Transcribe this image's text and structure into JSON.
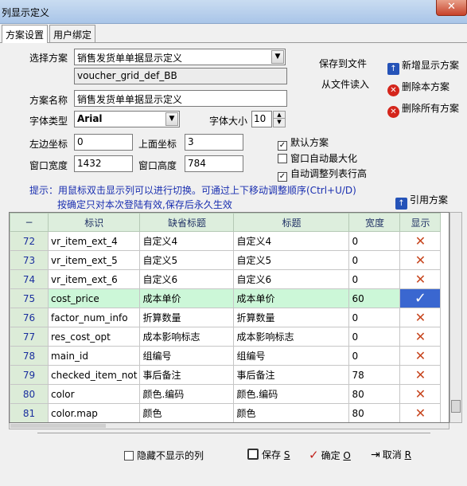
{
  "window": {
    "title": "列显示定义",
    "close_glyph": "✕"
  },
  "tabs": [
    {
      "label": "方案设置",
      "active": true
    },
    {
      "label": "用户绑定",
      "active": false
    }
  ],
  "form": {
    "scheme_label": "选择方案",
    "scheme_value": "销售发货单单据显示定义",
    "scheme_code": "voucher_grid_def_BB",
    "name_label": "方案名称",
    "name_value": "销售发货单单据显示定义",
    "font_type_label": "字体类型",
    "font_type_value": "Arial",
    "font_size_label": "字体大小",
    "font_size_value": "10",
    "left_label": "左边坐标",
    "left_value": "0",
    "top_label": "上面坐标",
    "top_value": "3",
    "width_label": "窗口宽度",
    "width_value": "1432",
    "height_label": "窗口高度",
    "height_value": "784"
  },
  "options": [
    {
      "label": "默认方案",
      "checked": true
    },
    {
      "label": "窗口自动最大化",
      "checked": false
    },
    {
      "label": "自动调整列表行高",
      "checked": true
    }
  ],
  "actions": {
    "save_to_file": "保存到文件",
    "load_from_file": "从文件读入",
    "add_scheme": "新增显示方案",
    "delete_scheme": "删除本方案",
    "delete_all": "删除所有方案",
    "reference_scheme": "引用方案"
  },
  "hint": {
    "line1": "提示：用鼠标双击显示列可以进行切换。可通过上下移动调整顺序(Ctrl+U/D)",
    "line2": "按确定只对本次登陆有效,保存后永久生效"
  },
  "grid": {
    "corner": "−",
    "columns": [
      "标识",
      "缺省标题",
      "标题",
      "宽度",
      "显示"
    ],
    "rows": [
      {
        "no": "72",
        "id": "vr_item_ext_4",
        "default_title": "自定义4",
        "title": "自定义4",
        "width": "0",
        "show": false
      },
      {
        "no": "73",
        "id": "vr_item_ext_5",
        "default_title": "自定义5",
        "title": "自定义5",
        "width": "0",
        "show": false
      },
      {
        "no": "74",
        "id": "vr_item_ext_6",
        "default_title": "自定义6",
        "title": "自定义6",
        "width": "0",
        "show": false
      },
      {
        "no": "75",
        "id": "cost_price",
        "default_title": "成本单价",
        "title": "成本单价",
        "width": "60",
        "show": true,
        "selected": true
      },
      {
        "no": "76",
        "id": "factor_num_info",
        "default_title": "折算数量",
        "title": "折算数量",
        "width": "0",
        "show": false
      },
      {
        "no": "77",
        "id": "res_cost_opt",
        "default_title": "成本影响标志",
        "title": "成本影响标志",
        "width": "0",
        "show": false
      },
      {
        "no": "78",
        "id": "main_id",
        "default_title": "组编号",
        "title": "组编号",
        "width": "0",
        "show": false
      },
      {
        "no": "79",
        "id": "checked_item_not",
        "default_title": "事后备注",
        "title": "事后备注",
        "width": "78",
        "show": false
      },
      {
        "no": "80",
        "id": "color",
        "default_title": "颜色.编码",
        "title": "颜色.编码",
        "width": "80",
        "show": false
      },
      {
        "no": "81",
        "id": "color.map",
        "default_title": "颜色",
        "title": "颜色",
        "width": "80",
        "show": false
      }
    ],
    "x_glyph": "✕",
    "check_glyph": "✓"
  },
  "footer": {
    "hide_hidden_label": "隐藏不显示的列",
    "save_label": "保存",
    "save_key": "S",
    "ok_label": "确定",
    "ok_key": "O",
    "cancel_label": "取消",
    "cancel_key": "R"
  }
}
